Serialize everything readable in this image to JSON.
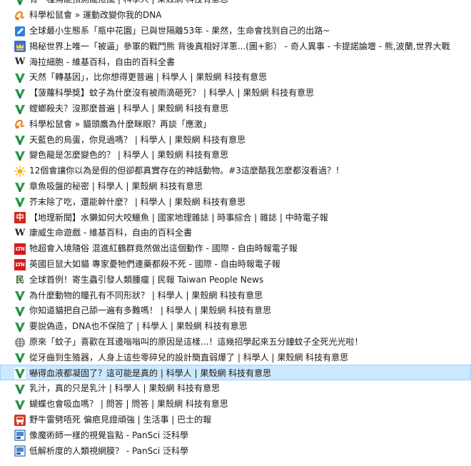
{
  "bookmarks": [
    {
      "icon": "guokr-icon",
      "title": "有一種烏能預測龍捲風 | 科學人 | 果殼網 科技有意思"
    },
    {
      "icon": "songshu-icon",
      "title": "科學松鼠會 » 運動改變你我的DNA"
    },
    {
      "icon": "pencil-icon",
      "title": "全球最小生態系「瓶中花園」已與世隔離53年 - 果然，生命會找到自己的出路~"
    },
    {
      "icon": "crown-icon",
      "title": "揭秘世界上唯一「被逼」參軍的戰鬥熊 背後真相好洋蔥...(圖+影） - 奇人異事 - 卡提諾論壇 - 熊,波蘭,世界大戰"
    },
    {
      "icon": "wikipedia-icon",
      "title": "海拉細胞 - 維基百科，自由的百科全書"
    },
    {
      "icon": "guokr-icon",
      "title": "天然「轉基因」，比你想得更普遍 | 科學人 | 果殼網 科技有意思"
    },
    {
      "icon": "guokr-icon",
      "title": "【菠蘿科學獎】蚊子為什麼沒有被雨滴砸死？ | 科學人 | 果殼網 科技有意思"
    },
    {
      "icon": "guokr-icon",
      "title": "螳螂殺夫？沒那麼普遍 | 科學人 | 果殼網 科技有意思"
    },
    {
      "icon": "songshu-icon",
      "title": "科學松鼠會 » 貓頭鷹為什麼眯眼？再談「應激」"
    },
    {
      "icon": "guokr-icon",
      "title": "天藍色的烏蛋，你見過嗎？ | 科學人 | 果殼網 科技有意思"
    },
    {
      "icon": "guokr-icon",
      "title": "變色龍是怎麼變色的？ | 科學人 | 果殼網 科技有意思"
    },
    {
      "icon": "sun-icon",
      "title": "12個會讓你以為是假的但卻都真實存在的神話動物。#3這麼酷我怎麼都沒看過？！"
    },
    {
      "icon": "guokr-icon",
      "title": "章魚吸盤的秘密 | 科學人 | 果殼網 科技有意思"
    },
    {
      "icon": "guokr-icon",
      "title": "芥末除了吃，還能幹什麼？ | 科學人 | 果殼網 科技有意思"
    },
    {
      "icon": "chinatimes-icon",
      "glyph": "中",
      "title": "【地理新聞】水獺如何大咬鱷魚 | 國家地理雜誌 | 時事綜合 | 雜誌 | 中時電子報"
    },
    {
      "icon": "wikipedia-icon",
      "title": "康威生命遊戲 - 維基百科，自由的百科全書"
    },
    {
      "icon": "ltn-icon",
      "glyph": "LTN",
      "title": "牠超會入境隨俗 混進紅鶴群竟然做出這個動作 - 國際 - 自由時報電子報"
    },
    {
      "icon": "ltn-icon",
      "glyph": "LTN",
      "title": "英國巨鼠大如貓 專家憂牠們連藥都殺不死 - 國際 - 自由時報電子報"
    },
    {
      "icon": "peoplenews-icon",
      "glyph": "民",
      "title": "全球首例！寄生蟲引發人類腫瘤 | 民報 Taiwan People News"
    },
    {
      "icon": "guokr-icon",
      "title": "為什麼動物的瞳孔有不同形狀？ | 科學人 | 果殼網 科技有意思"
    },
    {
      "icon": "guokr-icon",
      "title": "你知道貓把自己舔一遍有多難嗎！ | 科學人 | 果殼網 科技有意思"
    },
    {
      "icon": "guokr-icon",
      "title": "要說偽造，DNA也不保險了 | 科學人 | 果殼網 科技有意思"
    },
    {
      "icon": "globe-icon",
      "title": "原來「蚊子」喜歡在耳邊嗡嗡叫的原因是這樣...！這幾招學起來五分鐘蚊子全死光光啦！"
    },
    {
      "icon": "guokr-icon",
      "title": "從牙齒到生殖器，人身上這些零碎兒的設計簡直弱爆了 | 科學人 | 果殼網 科技有意思"
    },
    {
      "icon": "guokr-icon",
      "title": "嚇得血液都凝固了？這可能是真的 | 科學人 | 果殼網 科技有意思",
      "selected": true
    },
    {
      "icon": "guokr-icon",
      "title": "乳汁，真的只是乳汁 | 科學人 | 果殼網 科技有意思"
    },
    {
      "icon": "guokr-icon",
      "title": "蝴蝶也會吸血嗎？ | 問答 | 問答 | 果殼網 科技有意思"
    },
    {
      "icon": "bus-icon",
      "title": "野牛雷劈唔死 偏疤見證頑強 | 生活事 | 巴士的報"
    },
    {
      "icon": "pansci-icon",
      "title": "像魔術師一樣的視覺盲點 - PanSci 泛科學"
    },
    {
      "icon": "pansci-icon",
      "title": "低解析度的人類視網膜？ - PanSci 泛科學"
    }
  ],
  "colors": {
    "guokr_green": "#2aa14a",
    "guokr_dark": "#1d6b34",
    "selection_bg": "#cce8ff",
    "selection_border": "#99d1ff",
    "hover_bg": "#e5f3ff"
  }
}
